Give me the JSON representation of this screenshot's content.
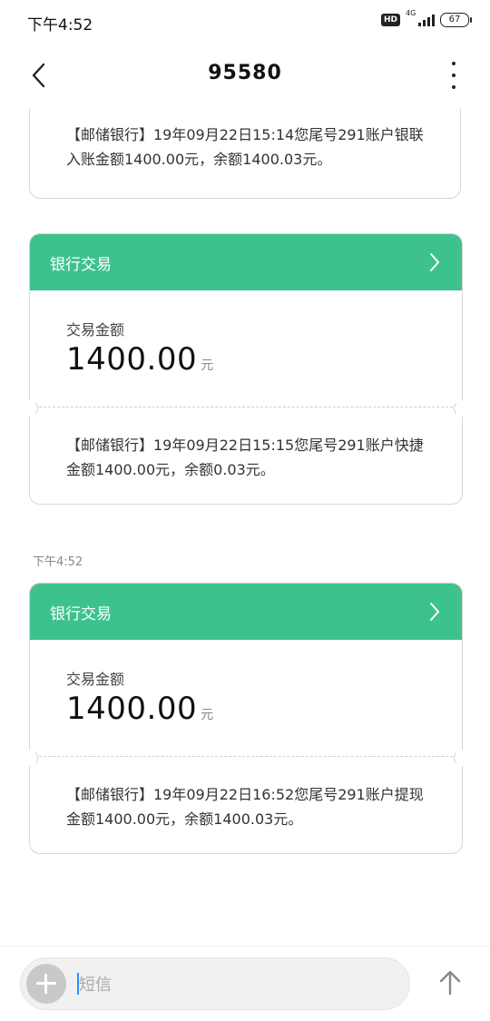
{
  "status_bar": {
    "time": "下午4:52",
    "hd_label": "HD",
    "network": "4G",
    "battery": "67"
  },
  "header": {
    "title": "95580"
  },
  "messages": [
    {
      "text": "【邮储银行】19年09月22日15:14您尾号291账户银联入账金额1400.00元，余额1400.03元。"
    },
    {
      "card_title": "银行交易",
      "amount_label": "交易金额",
      "amount": "1400.00",
      "unit": "元",
      "text": "【邮储银行】19年09月22日15:15您尾号291账户快捷金额1400.00元，余额0.03元。"
    },
    {
      "timestamp": "下午4:52",
      "card_title": "银行交易",
      "amount_label": "交易金额",
      "amount": "1400.00",
      "unit": "元",
      "text": "【邮储银行】19年09月22日16:52您尾号291账户提现金额1400.00元，余额1400.03元。"
    }
  ],
  "composer": {
    "placeholder": "短信",
    "value": ""
  },
  "colors": {
    "accent": "#3ec28d",
    "caret": "#2a8ef5"
  },
  "icons": {
    "back": "back-arrow-icon",
    "more": "more-vertical-icon",
    "chevron": "chevron-right-icon",
    "add": "plus-icon",
    "send": "send-arrow-icon"
  }
}
